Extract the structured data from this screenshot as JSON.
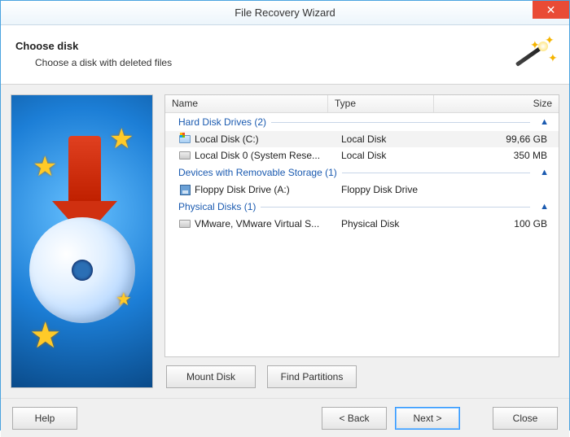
{
  "window": {
    "title": "File Recovery Wizard",
    "close_tooltip": "Close"
  },
  "header": {
    "title": "Choose disk",
    "subtitle": "Choose a disk with deleted files"
  },
  "columns": {
    "name": "Name",
    "type": "Type",
    "size": "Size"
  },
  "groups": [
    {
      "label": "Hard Disk Drives",
      "count": 2
    },
    {
      "label": "Devices with Removable Storage",
      "count": 1
    },
    {
      "label": "Physical Disks",
      "count": 1
    }
  ],
  "disks": {
    "hdd": [
      {
        "name": "Local Disk (C:)",
        "type": "Local Disk",
        "size": "99,66 GB",
        "selected": true,
        "icon": "win"
      },
      {
        "name": "Local Disk 0 (System Rese...",
        "type": "Local Disk",
        "size": "350 MB",
        "selected": false,
        "icon": "gray"
      }
    ],
    "removable": [
      {
        "name": "Floppy Disk Drive (A:)",
        "type": "Floppy Disk Drive",
        "size": "",
        "selected": false,
        "icon": "floppy"
      }
    ],
    "physical": [
      {
        "name": "VMware, VMware Virtual S...",
        "type": "Physical Disk",
        "size": "100 GB",
        "selected": false,
        "icon": "gray"
      }
    ]
  },
  "actions": {
    "mount": "Mount Disk",
    "find": "Find Partitions"
  },
  "footer": {
    "help": "Help",
    "back": "< Back",
    "next": "Next >",
    "close": "Close"
  }
}
